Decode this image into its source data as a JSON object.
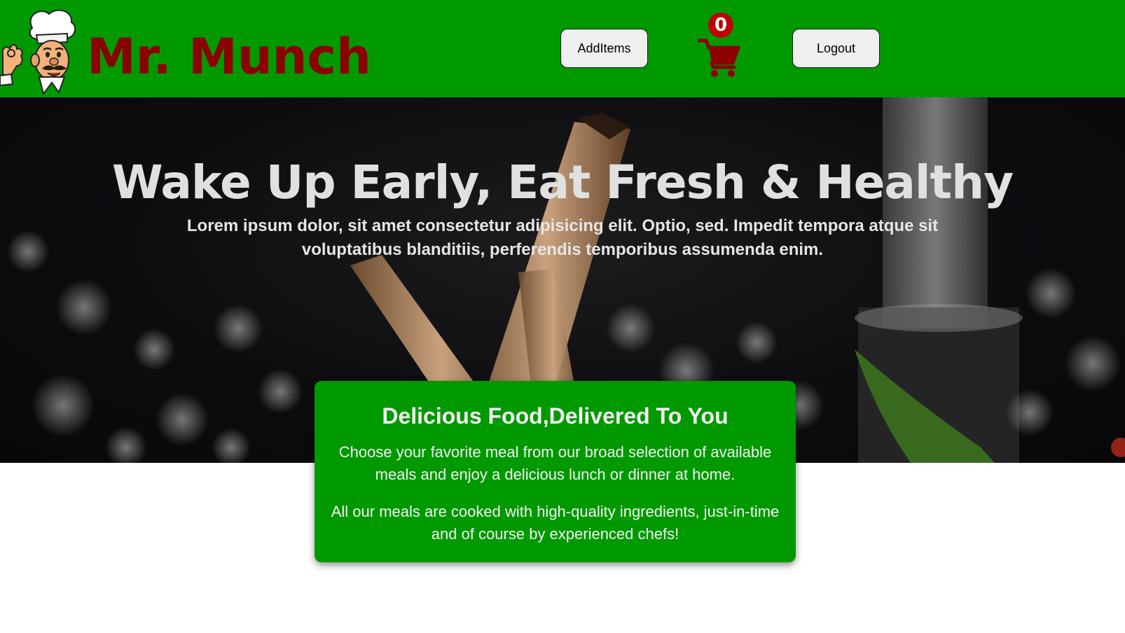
{
  "header": {
    "brand": "Mr. Munch",
    "add_items_label": "AddItems",
    "cart_count": "0",
    "logout_label": "Logout",
    "background_color": "#009900",
    "brand_color": "#8b0000"
  },
  "hero": {
    "heading": "Wake Up Early, Eat Fresh & Healthy",
    "subtext": "Lorem ipsum dolor, sit amet consectetur adipisicing elit. Optio, sed. Impedit tempora atque sit voluptatibus blanditiis, perferendis temporibus assumenda enim."
  },
  "info_card": {
    "title": "Delicious Food,Delivered To You",
    "paragraph_1": "Choose your favorite meal from our broad selection of available meals and enjoy a delicious lunch or dinner at home.",
    "paragraph_2": "All our meals are cooked with high-quality ingredients, just-in-time and of course by experienced chefs!",
    "background_color": "#009900"
  },
  "icons": {
    "logo": "chef-logo-icon",
    "cart": "shopping-cart-icon"
  }
}
